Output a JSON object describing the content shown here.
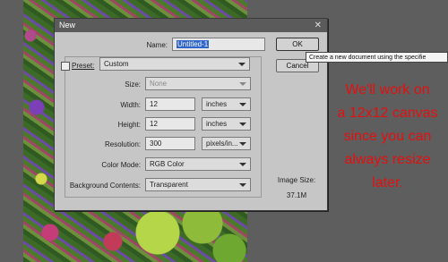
{
  "dialog": {
    "title": "New",
    "name_label": "Name:",
    "name_value": "Untitled-1",
    "preset_label": "Preset:",
    "preset_value": "Custom",
    "size_label": "Size:",
    "size_value": "None",
    "width_label": "Width:",
    "width_value": "12",
    "width_unit": "inches",
    "height_label": "Height:",
    "height_value": "12",
    "height_unit": "inches",
    "resolution_label": "Resolution:",
    "resolution_value": "300",
    "resolution_unit": "pixels/in...",
    "color_mode_label": "Color Mode:",
    "color_mode_value": "RGB Color",
    "background_label": "Background Contents:",
    "background_value": "Transparent",
    "image_size_label": "Image Size:",
    "image_size_value": "37.1M",
    "ok_label": "OK",
    "cancel_label": "Cancel"
  },
  "tooltip": "Create a new document using the specifie",
  "note": [
    "We'll work on",
    "a 12x12 canvas",
    "since you can",
    "always resize",
    "later."
  ],
  "colors": {
    "note": "#e31010",
    "titlebar": "#5b5b5b",
    "selection": "#2f64c8",
    "dialog_bg": "#c6c6c6"
  },
  "icons": [
    "close-icon",
    "dropdown-arrow-icon"
  ]
}
